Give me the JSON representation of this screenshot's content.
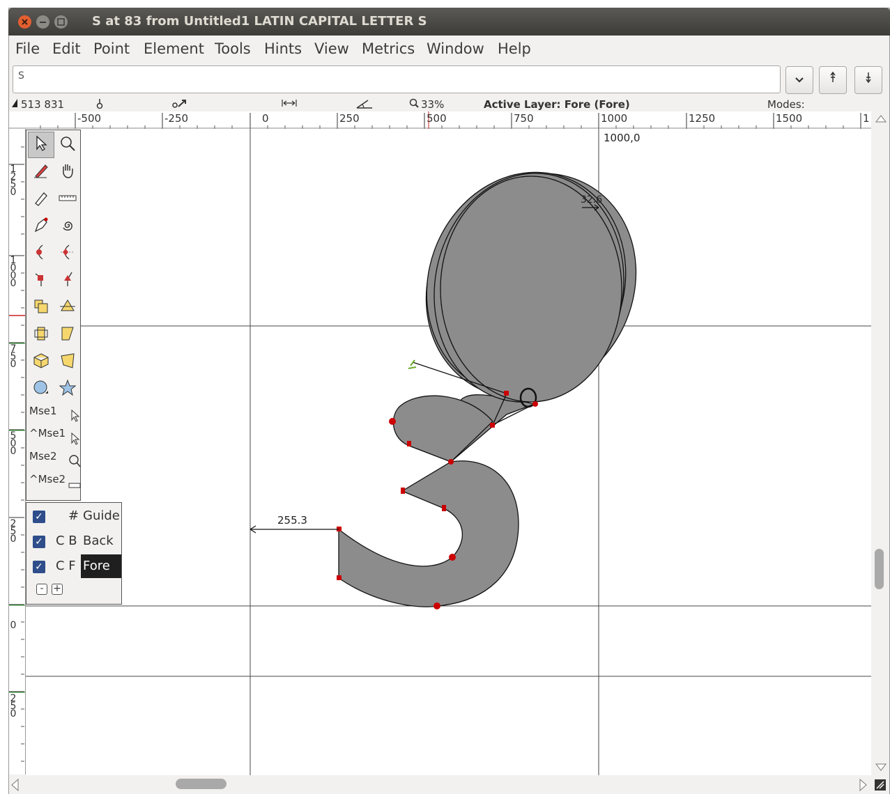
{
  "window": {
    "title": "S at 83 from Untitled1 LATIN CAPITAL LETTER S"
  },
  "menu": [
    "File",
    "Edit",
    "Point",
    "Element",
    "Tools",
    "Hints",
    "View",
    "Metrics",
    "Window",
    "Help"
  ],
  "glyph_field": {
    "value": "S"
  },
  "infobar": {
    "coords": "513 831",
    "zoom": "33%",
    "active_layer": "Active Layer: Fore (Fore)",
    "modes": "Modes:"
  },
  "hruler_ticks": [
    "-500",
    "-250",
    "0",
    "250",
    "500",
    "750",
    "1000",
    "1250",
    "1500",
    "1"
  ],
  "vruler_ticks": [
    "1250",
    "1000",
    "750",
    "500",
    "250",
    "0",
    "250"
  ],
  "tools": [
    "pointer-tool",
    "magnify-tool",
    "freehand-tool",
    "scroll-tool",
    "pencil-tool",
    "ruler-tool",
    "pen-tool",
    "spiro-tool",
    "curve-point-tool",
    "hv-curve-point-tool",
    "corner-point-tool",
    "tangent-point-tool",
    "scale-tool",
    "flip-tool",
    "rotate-tool",
    "skew-tool",
    "3d-rotate-tool",
    "perspective-tool",
    "ellipse-tool",
    "star-tool"
  ],
  "mouse_bindings": [
    "Mse1",
    "^Mse1",
    "Mse2",
    "^Mse2"
  ],
  "layers": [
    {
      "prefix": "#",
      "name": "Guide",
      "checked": true
    },
    {
      "prefix": "C B",
      "name": "Back",
      "checked": true
    },
    {
      "prefix": "C F",
      "name": "Fore",
      "checked": true,
      "selected": true
    }
  ],
  "canvas_labels": {
    "advance_coord": "1000,0",
    "left_bearing": "255.3",
    "right_bearing": "32.6"
  },
  "colors": {
    "titlebar": "#3d3c38",
    "glyph_fill": "#8c8c8c",
    "point_red": "#cc0000",
    "checkbox": "#2e4d8a"
  }
}
